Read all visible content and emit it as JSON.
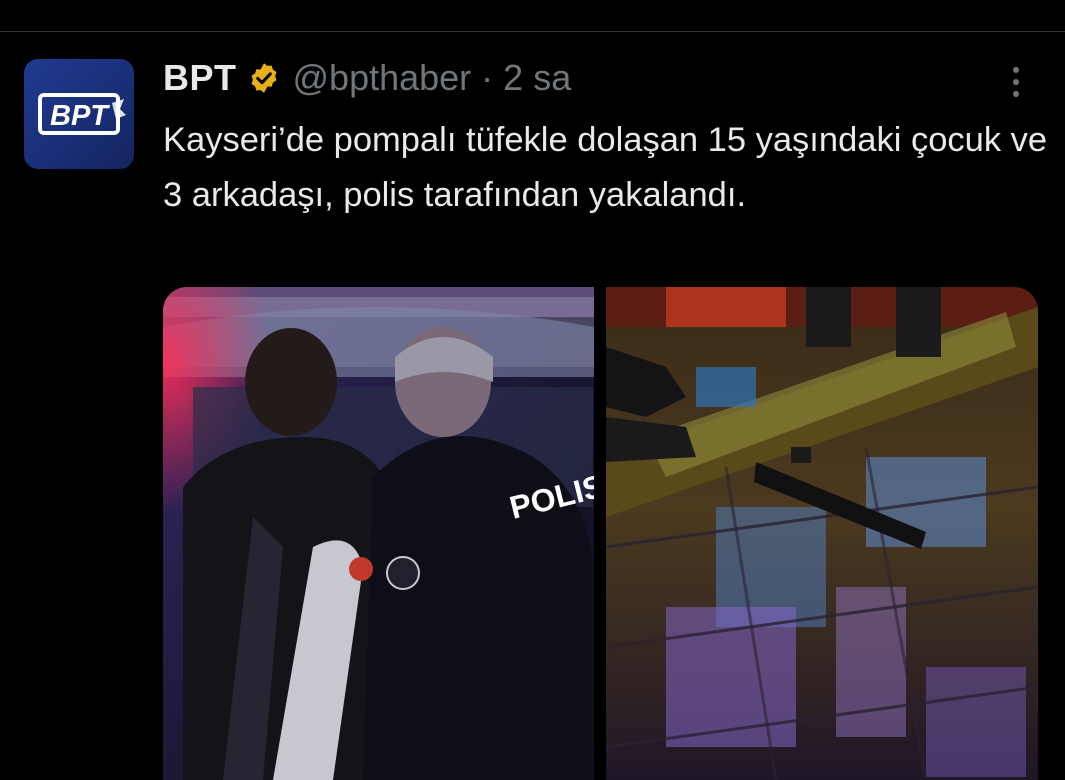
{
  "tweet": {
    "avatar": {
      "logo_text": "BPT",
      "colors": {
        "background": "#1f3a8f",
        "logo": "#ffffff"
      }
    },
    "display_name": "BPT",
    "verified_badge": {
      "icon": "verified-gold-badge-icon",
      "color": "#e8b019"
    },
    "handle": "@bpthaber",
    "separator": "·",
    "timestamp": "2 sa",
    "more_icon": "more-options-icon",
    "text": "Kayseri’de pompalı tüfekle dolaşan 15 yaşındaki çocuk ve 3 arkadaşı, polis tarafından yakalandı.",
    "media": [
      {
        "description_icon": "photo",
        "vest_text": "POLIS"
      },
      {
        "description_icon": "photo"
      }
    ]
  },
  "colors": {
    "background": "#000000",
    "primary_text": "#e7e9ea",
    "secondary_text": "#71767b",
    "divider": "#2f3336"
  }
}
